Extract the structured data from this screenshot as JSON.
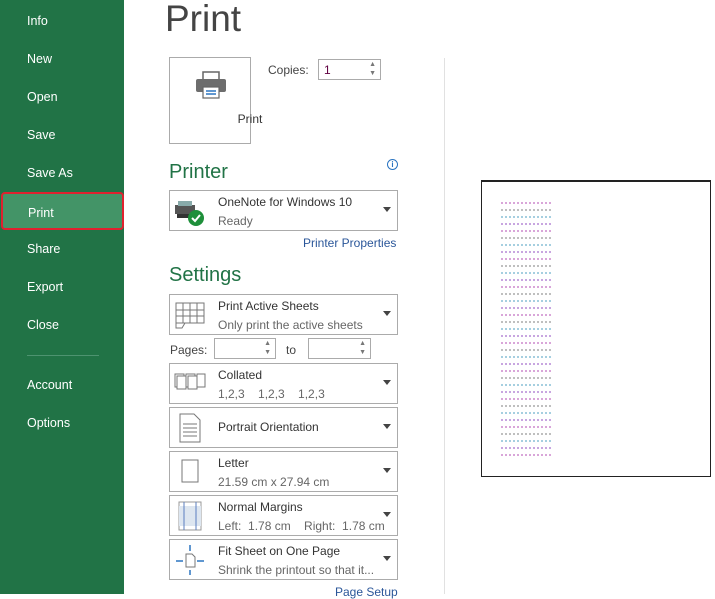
{
  "nav": {
    "items": [
      {
        "label": "Info",
        "active": false
      },
      {
        "label": "New",
        "active": false
      },
      {
        "label": "Open",
        "active": false
      },
      {
        "label": "Save",
        "active": false
      },
      {
        "label": "Save As",
        "active": false
      },
      {
        "label": "Print",
        "active": true
      },
      {
        "label": "Share",
        "active": false
      },
      {
        "label": "Export",
        "active": false
      },
      {
        "label": "Close",
        "active": false
      },
      {
        "label": "Account",
        "active": false
      },
      {
        "label": "Options",
        "active": false
      }
    ]
  },
  "title": "Print",
  "print_button": {
    "label": "Print",
    "icon": "printer-icon"
  },
  "copies": {
    "label": "Copies:",
    "value": "1"
  },
  "printer": {
    "heading": "Printer",
    "name": "OneNote for Windows 10",
    "status": "Ready",
    "properties_link": "Printer Properties",
    "info_icon": "info-icon"
  },
  "settings": {
    "heading": "Settings",
    "what": {
      "title": "Print Active Sheets",
      "subtitle": "Only print the active sheets"
    },
    "pages": {
      "label": "Pages:",
      "from": "",
      "to_label": "to",
      "to": ""
    },
    "collation": {
      "title": "Collated",
      "subtitle": "1,2,3    1,2,3    1,2,3"
    },
    "orientation": {
      "title": "Portrait Orientation"
    },
    "paper": {
      "title": "Letter",
      "subtitle": "21.59 cm x 27.94 cm"
    },
    "margins": {
      "title": "Normal Margins",
      "subtitle": "Left:  1.78 cm    Right:  1.78 cm"
    },
    "scaling": {
      "title": "Fit Sheet on One Page",
      "subtitle": "Shrink the printout so that it..."
    },
    "page_setup_link": "Page Setup"
  },
  "colors": {
    "nav_bg": "#217346",
    "nav_active": "#439467",
    "highlight_border": "#e0212f",
    "accent": "#217346",
    "link": "#2a5699"
  }
}
